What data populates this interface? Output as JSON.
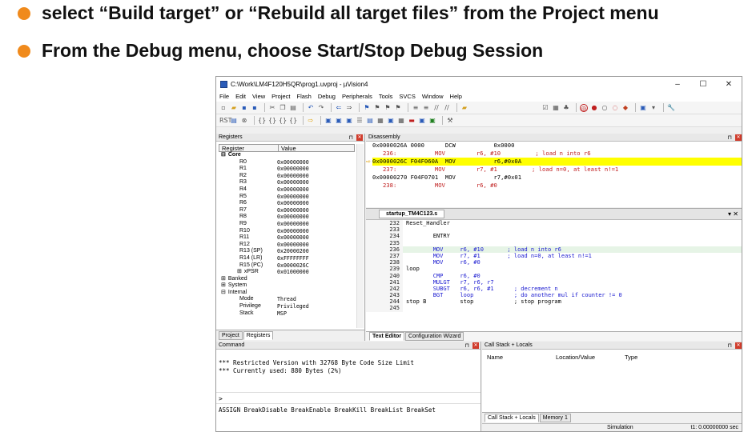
{
  "bullets": [
    "select “Build target” or “Rebuild all target files” from the Project menu",
    "From the Debug menu, choose Start/Stop Debug Session"
  ],
  "accent": "#f08a1c",
  "window": {
    "title": "C:\\Work\\LM4F120H5QR\\prog1.uvproj - µVision4",
    "controls": [
      "–",
      "☐",
      "✕"
    ]
  },
  "menu": [
    "File",
    "Edit",
    "View",
    "Project",
    "Flash",
    "Debug",
    "Peripherals",
    "Tools",
    "SVCS",
    "Window",
    "Help"
  ],
  "registers": {
    "title": "Registers",
    "col_register": "Register",
    "col_value": "Value",
    "rows": [
      {
        "name": "Core",
        "value": "",
        "indent": 0,
        "bold": true,
        "prefix": "⊟"
      },
      {
        "name": "R0",
        "value": "0x00000000",
        "indent": 2
      },
      {
        "name": "R1",
        "value": "0x00000000",
        "indent": 2
      },
      {
        "name": "R2",
        "value": "0x00000000",
        "indent": 2
      },
      {
        "name": "R3",
        "value": "0x00000000",
        "indent": 2
      },
      {
        "name": "R4",
        "value": "0x00000000",
        "indent": 2
      },
      {
        "name": "R5",
        "value": "0x00000000",
        "indent": 2
      },
      {
        "name": "R6",
        "value": "0x00000000",
        "indent": 2
      },
      {
        "name": "R7",
        "value": "0x00000000",
        "indent": 2
      },
      {
        "name": "R8",
        "value": "0x00000000",
        "indent": 2
      },
      {
        "name": "R9",
        "value": "0x00000000",
        "indent": 2
      },
      {
        "name": "R10",
        "value": "0x00000000",
        "indent": 2
      },
      {
        "name": "R11",
        "value": "0x00000000",
        "indent": 2
      },
      {
        "name": "R12",
        "value": "0x00000000",
        "indent": 2
      },
      {
        "name": "R13 (SP)",
        "value": "0x20000200",
        "indent": 2
      },
      {
        "name": "R14 (LR)",
        "value": "0xFFFFFFFF",
        "indent": 2
      },
      {
        "name": "R15 (PC)",
        "value": "0x0000026C",
        "indent": 2
      },
      {
        "name": "xPSR",
        "value": "0x01000000",
        "indent": 2,
        "prefix": "⊞"
      },
      {
        "name": "Banked",
        "value": "",
        "indent": 0,
        "prefix": "⊞"
      },
      {
        "name": "System",
        "value": "",
        "indent": 0,
        "prefix": "⊞"
      },
      {
        "name": "Internal",
        "value": "",
        "indent": 0,
        "prefix": "⊟"
      },
      {
        "name": "Mode",
        "value": "Thread",
        "indent": 2
      },
      {
        "name": "Privilege",
        "value": "Privileged",
        "indent": 2
      },
      {
        "name": "Stack",
        "value": "MSP",
        "indent": 2
      }
    ],
    "tabs": [
      "Project",
      "Registers"
    ]
  },
  "disassembly": {
    "title": "Disassembly",
    "lines": [
      {
        "text": "0x0000026A 0000      DCW           0x0000",
        "hl": false
      },
      {
        "text": "   236:           MOV         r6, #10          ; load n into r6",
        "hl": false
      },
      {
        "text": "0x0000026C F04F060A  MOV           r6,#0x0A",
        "hl": true
      },
      {
        "text": "   237:           MOV         r7, #1          ; load n=0, at least n!=1",
        "hl": false
      },
      {
        "text": "0x00000270 F04F0701  MOV           r7,#0x01",
        "hl": false
      },
      {
        "text": "   238:           MOV         r6, #0",
        "hl": false
      }
    ]
  },
  "editor": {
    "tab": "startup_TM4C123.s",
    "lines": [
      {
        "n": "232",
        "code": "Reset_Handler",
        "cls": ""
      },
      {
        "n": "233",
        "code": "",
        "cls": ""
      },
      {
        "n": "234",
        "code": "        ENTRY",
        "cls": ""
      },
      {
        "n": "235",
        "code": "",
        "cls": ""
      },
      {
        "n": "236",
        "code": "        MOV     r6, #10       ; load n into r6",
        "cls": "cur"
      },
      {
        "n": "237",
        "code": "        MOV     r7, #1        ; load n=0, at least n!=1",
        "cls": ""
      },
      {
        "n": "238",
        "code": "        MOV     r6, #0",
        "cls": ""
      },
      {
        "n": "239",
        "code": "loop",
        "cls": ""
      },
      {
        "n": "240",
        "code": "        CMP     r6, #0",
        "cls": ""
      },
      {
        "n": "241",
        "code": "        MULGT   r7, r6, r7",
        "cls": ""
      },
      {
        "n": "242",
        "code": "        SUBGT   r6, r6, #1      ; decrement n",
        "cls": ""
      },
      {
        "n": "243",
        "code": "        BGT     loop            ; do another mul if counter != 0",
        "cls": ""
      },
      {
        "n": "244",
        "code": "stop B          stop            ; stop program",
        "cls": ""
      },
      {
        "n": "245",
        "code": "",
        "cls": ""
      }
    ],
    "bottom_tabs": [
      "Text Editor",
      "Configuration Wizard"
    ]
  },
  "command": {
    "title": "Command",
    "lines": [
      "*** Restricted Version with 32768 Byte Code Size Limit",
      "*** Currently used: 880 Bytes (2%)"
    ],
    "prompt": ">",
    "hints": "ASSIGN BreakDisable BreakEnable BreakKill BreakList BreakSet"
  },
  "callstack": {
    "title": "Call Stack + Locals",
    "cols": [
      "Name",
      "Location/Value",
      "Type"
    ],
    "tabs": [
      "Call Stack + Locals",
      "Memory 1"
    ]
  },
  "status": {
    "mode": "Simulation",
    "time": "t1: 0.00000000 sec"
  }
}
